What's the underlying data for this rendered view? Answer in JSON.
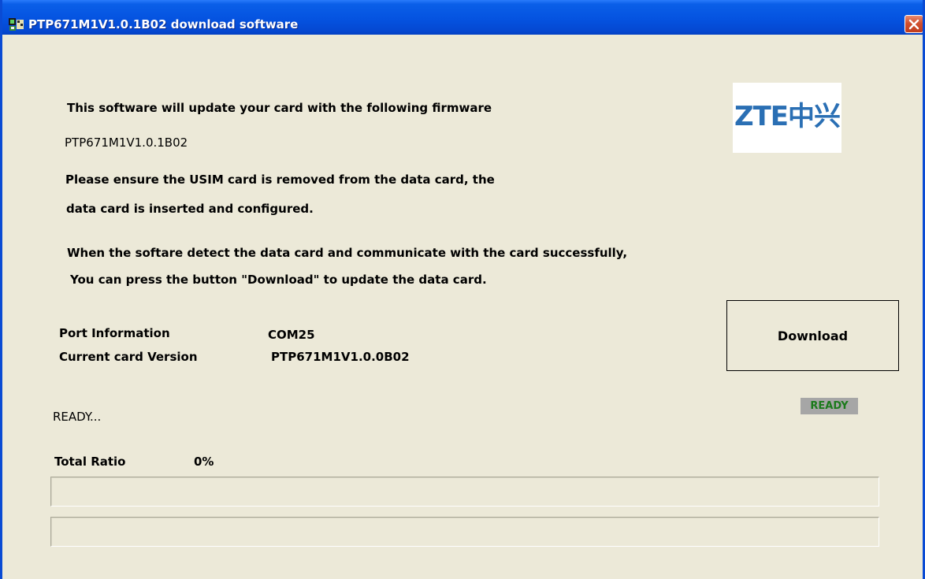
{
  "window": {
    "title": "PTP671M1V1.0.1B02 download software",
    "accent_color": "#0553e0"
  },
  "info": {
    "intro": "This software will update your card with the following firmware",
    "firmware": "PTP671M1V1.0.1B02",
    "ensure_line1": "Please ensure the USIM card is removed from the data card, the",
    "ensure_line2": "data card is inserted and configured.",
    "detect_line1": "When the softare detect the data card and communicate with the card successfully,",
    "detect_line2": "You can press the button \"Download\" to update the data card."
  },
  "logo": {
    "text": "ZTE中兴",
    "color": "#2a6fb4"
  },
  "port": {
    "label": "Port Information",
    "value": "COM25"
  },
  "version": {
    "label": "Current card Version",
    "value": "PTP671M1V1.0.0B02"
  },
  "download_button": {
    "label": "Download"
  },
  "status": {
    "message": "READY...",
    "badge": "READY",
    "badge_color": "#1b7a1b"
  },
  "progress": {
    "label": "Total Ratio",
    "value_text": "0%",
    "total_fraction": 0,
    "file_fraction": 0
  }
}
